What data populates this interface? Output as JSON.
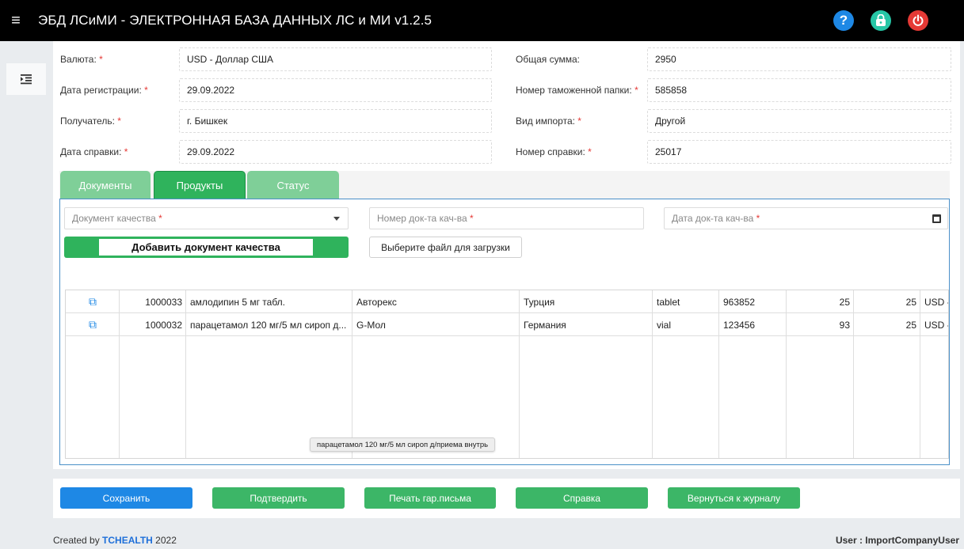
{
  "header": {
    "title": "ЭБД ЛСиМИ - ЭЛЕКТРОННАЯ БАЗА ДАННЫХ ЛС и МИ v1.2.5",
    "menu_glyph": "≡",
    "help_glyph": "?",
    "lock_glyph": "🔒",
    "power_glyph": "⏻"
  },
  "sidebar": {
    "toggle_glyph": "⇥"
  },
  "form": {
    "currency_label": "Валюта:",
    "currency_value": "USD - Доллар США",
    "reg_date_label": "Дата регистрации:",
    "reg_date_value": "29.09.2022",
    "recipient_label": "Получатель:",
    "recipient_value": "г. Бишкек",
    "cert_date_label": "Дата справки:",
    "cert_date_value": "29.09.2022",
    "total_label": "Общая сумма:",
    "total_value": "2950",
    "customs_label": "Номер таможенной папки:",
    "customs_value": "585858",
    "import_type_label": "Вид импорта:",
    "import_type_value": "Другой",
    "cert_number_label": "Номер справки:",
    "cert_number_value": "25017",
    "required_mark": "*"
  },
  "tabs": [
    {
      "label": "Документы"
    },
    {
      "label": "Продукты"
    },
    {
      "label": "Статус"
    }
  ],
  "products": {
    "quality_doc_placeholder": "Документ качества",
    "quality_doc_no_placeholder": "Номер док-та кач-ва",
    "quality_doc_date_placeholder": "Дата док-та кач-ва",
    "add_quality_doc_label": "Добавить документ качества",
    "file_upload_label": "Выберите файл для загрузки",
    "edit_glyph": "⧉",
    "rows": [
      {
        "id": "1000033",
        "name": "амлодипин 5 мг табл.",
        "manufacturer": "Авторекс",
        "country": "Турция",
        "form": "tablet",
        "code": "963852",
        "qty": "25",
        "price": "25",
        "currency": "USD -"
      },
      {
        "id": "1000032",
        "name": "парацетамол 120 мг/5 мл сироп д...",
        "manufacturer": "G-Мол",
        "country": "Германия",
        "form": "vial",
        "code": "123456",
        "qty": "93",
        "price": "25",
        "currency": "USD -"
      }
    ],
    "tooltip": "парацетамол 120 мг/5 мл сироп д/приема внутрь"
  },
  "actions": {
    "save": "Сохранить",
    "confirm": "Подтвердить",
    "print": "Печать гар.письма",
    "certificate": "Справка",
    "back": "Вернуться к журналу"
  },
  "footer": {
    "created_prefix": "Created by",
    "brand": "TCHEALTH",
    "year": "2022",
    "user": "User : ImportCompanyUser"
  },
  "colors": {
    "topbar": "#000000",
    "green": "#2fb35c",
    "green_light": "#7fcf98",
    "blue": "#1e88e5",
    "danger": "#e53935"
  }
}
